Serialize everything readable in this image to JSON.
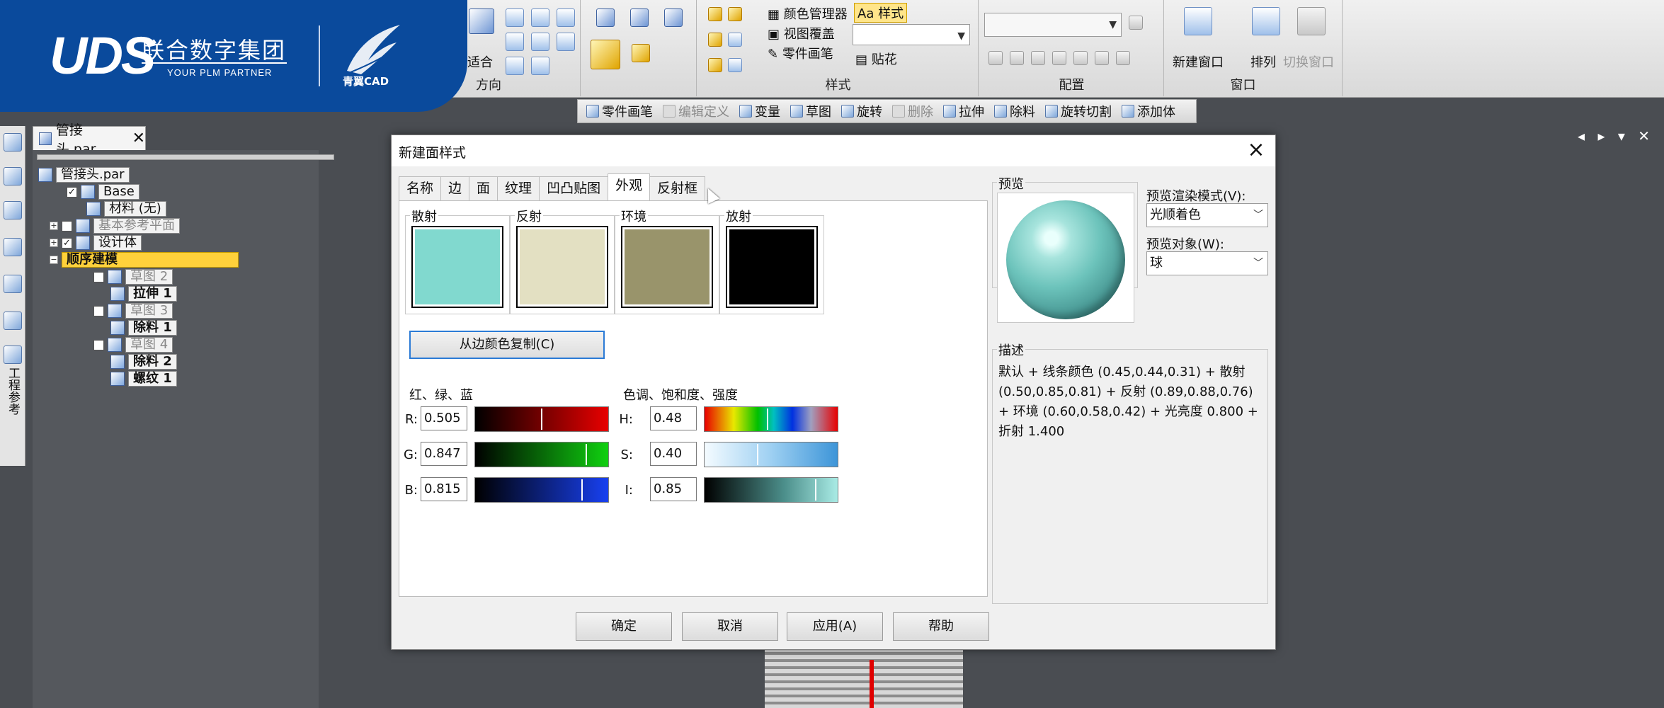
{
  "logo": {
    "uds": "UDS",
    "company": "联合数字集团",
    "tagline": "YOUR PLM PARTNER",
    "brand": "青翼CAD"
  },
  "ribbon": {
    "direction": {
      "fit_label": "适合",
      "group_label": "方向"
    },
    "style": {
      "color_manager": "颜色管理器",
      "view_overlay": "视图覆盖",
      "part_painter": "零件画笔",
      "style_button": "样式",
      "decal": "贴花",
      "group_label": "样式"
    },
    "config": {
      "group_label": "配置"
    },
    "window": {
      "new_window": "新建窗口",
      "arrange": "排列",
      "switch_window": "切换窗口",
      "group_label": "窗口"
    }
  },
  "subtoolbar": {
    "items": [
      {
        "label": "零件画笔",
        "enabled": true
      },
      {
        "label": "编辑定义",
        "enabled": false
      },
      {
        "label": "变量",
        "enabled": true
      },
      {
        "label": "草图",
        "enabled": true
      },
      {
        "label": "旋转",
        "enabled": true
      },
      {
        "label": "删除",
        "enabled": false
      },
      {
        "label": "拉伸",
        "enabled": true
      },
      {
        "label": "除料",
        "enabled": true
      },
      {
        "label": "旋转切割",
        "enabled": true
      },
      {
        "label": "添加体",
        "enabled": true
      }
    ]
  },
  "left_bar": {
    "label": "工程参考"
  },
  "document": {
    "tab_name": "管接头.par",
    "tree": [
      "管接头.par",
      "Base",
      "材料 (无)",
      "基本参考平面",
      "设计体",
      "顺序建模",
      "草图 2",
      "拉伸 1",
      "草图 3",
      "除料 1",
      "草图 4",
      "除料 2",
      "螺纹 1"
    ]
  },
  "dialog": {
    "title": "新建面样式",
    "tabs": [
      "名称",
      "边",
      "面",
      "纹理",
      "凹凸贴图",
      "外观",
      "反射框"
    ],
    "active_tab": "外观",
    "swatches": [
      {
        "label": "散射",
        "color": "#81d9cf"
      },
      {
        "label": "反射",
        "color": "#e3e0c2"
      },
      {
        "label": "环境",
        "color": "#99946b"
      },
      {
        "label": "放射",
        "color": "#000000"
      }
    ],
    "copy_from_edge": "从边颜色复制(C)",
    "rgb": {
      "label": "红、绿、蓝",
      "r_label": "R:",
      "r_value": "0.505",
      "r": 0.505,
      "g_label": "G:",
      "g_value": "0.847",
      "g": 0.847,
      "b_label": "B:",
      "b_value": "0.815",
      "b": 0.815
    },
    "hsi": {
      "label": "色调、饱和度、强度",
      "h_label": "H:",
      "h_value": "0.48",
      "h": 0.48,
      "s_label": "S:",
      "s_value": "0.40",
      "s": 0.4,
      "i_label": "I:",
      "i_value": "0.85",
      "i": 0.85
    },
    "preview": {
      "label": "预览",
      "render_mode_label": "预览渲染模式(V):",
      "render_mode_value": "光顺着色",
      "object_label": "预览对象(W):",
      "object_value": "球"
    },
    "description": {
      "label": "描述",
      "text": "默认 + 线条颜色 (0.45,0.44,0.31) + 散射 (0.50,0.85,0.81) + 反射 (0.89,0.88,0.76) + 环境 (0.60,0.58,0.42) + 光亮度 0.800 + 折射 1.400"
    },
    "buttons": {
      "ok": "确定",
      "cancel": "取消",
      "apply": "应用(A)",
      "help": "帮助"
    }
  }
}
